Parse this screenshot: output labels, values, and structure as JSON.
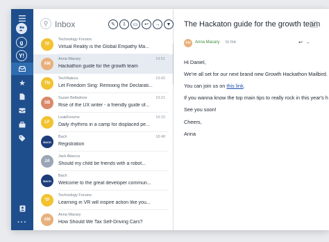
{
  "list": {
    "title": "Inbox",
    "actions": [
      "edit-icon",
      "archive-icon",
      "trash-icon",
      "reply-icon",
      "forward-icon"
    ],
    "emails": [
      {
        "from": "Technology Forums",
        "time": "",
        "subject": "Virtual Reality is the Global Empathy Ma...",
        "avatar": "TF",
        "color": "#f2c230"
      },
      {
        "from": "Anna Macary",
        "time": "19:51",
        "subject": "Hackathon guide for the growth team",
        "avatar": "AM",
        "color": "#e8b07c",
        "selected": true
      },
      {
        "from": "TechNatura",
        "time": "19:42",
        "subject": "Let Freedom Sing: Remixing the Declarati...",
        "avatar": "TN",
        "color": "#f2c230"
      },
      {
        "from": "Suzan Belladone",
        "time": "19:21",
        "subject": "Rise of the UX writer - a friendly guide of...",
        "avatar": "SB",
        "color": "#d9896a"
      },
      {
        "from": "LeakForums",
        "time": "19:15",
        "subject": "Daily rhythms in a camp for displaced pe...",
        "avatar": "LF",
        "color": "#f2c230"
      },
      {
        "from": "Bach",
        "time": "18:48",
        "subject": "Registration",
        "avatar": "BACH",
        "color": "#1d3d7a"
      },
      {
        "from": "Jack Abacca",
        "time": "",
        "subject": "Should my child be friends with a robot...",
        "avatar": "JA",
        "color": "#9aa5b5"
      },
      {
        "from": "Bach",
        "time": "",
        "subject": "Welcome to the great developer commun...",
        "avatar": "BACH",
        "color": "#1d3d7a"
      },
      {
        "from": "Technology Forums",
        "time": "",
        "subject": "Learning in VR will inspire action like you...",
        "avatar": "TF",
        "color": "#f2c230"
      },
      {
        "from": "Anna Macary",
        "time": "",
        "subject": "How Should We Tax Self-Driving Cars?",
        "avatar": "AM",
        "color": "#e8b07c"
      }
    ]
  },
  "reader": {
    "title": "The Hackaton guide for the growth team",
    "from": "Anna Macary",
    "to": "to me",
    "greeting": "Hi Daniel,",
    "p1": "We're all set for our next brand new Growth Hackathon Mailbird.",
    "p2_prefix": "You can join us on ",
    "p2_link": "this link",
    "p2_suffix": ".",
    "p3": "If you wanna know the top main tips to really rock in this year's h",
    "p4": "See you soon!",
    "p5": "Cheers,",
    "p6": "Anna"
  },
  "colors": {
    "sidebar": "#1f4e8c",
    "accent": "#2f6cb0",
    "link": "#1a4fb0"
  }
}
